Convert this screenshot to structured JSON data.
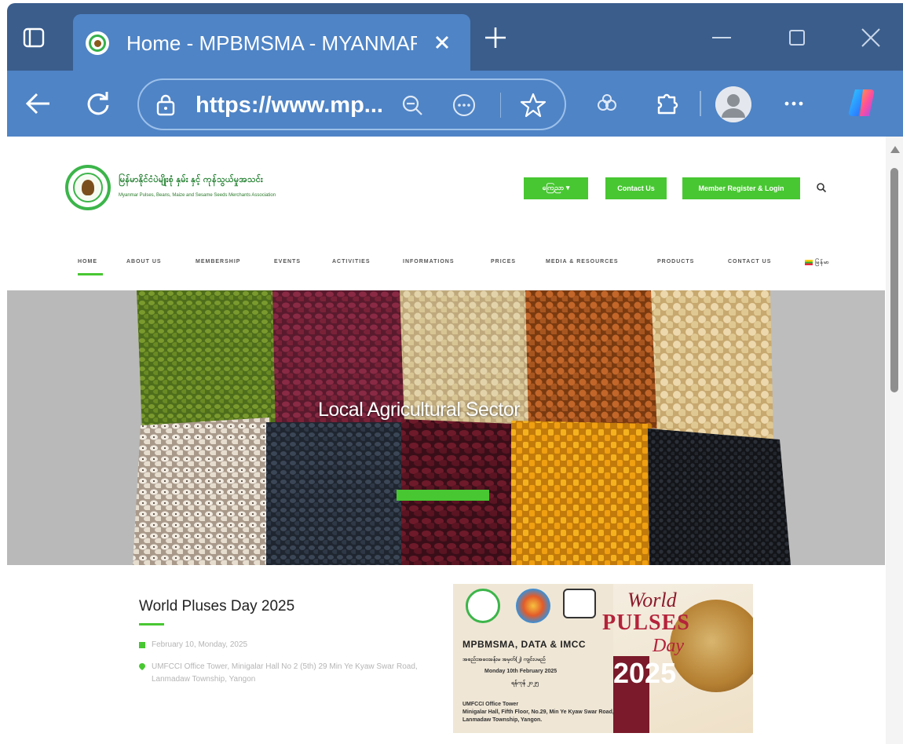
{
  "browser": {
    "tab_title": "Home - MPBMSMA - MYANMAR",
    "url": "https://www.mp...",
    "icons": [
      "tab-actions-icon",
      "favicon",
      "close-icon",
      "new-tab-icon",
      "minimize-icon",
      "maximize-icon",
      "window-close-icon",
      "back-icon",
      "refresh-icon",
      "site-info-icon",
      "zoom-out-icon",
      "more-in-address-icon",
      "favorite-star-icon",
      "extensions-icon",
      "collections-icon",
      "profile-avatar-icon",
      "settings-more-icon",
      "copilot-icon"
    ],
    "accent": "#4f84c6",
    "tabstrip_color": "#3a5d8c"
  },
  "site": {
    "logo_title": "မြန်မာနိုင်ငံပဲမျိုးစုံ နှမ်း နှင့် ကုန်သွယ်မှုအသင်း",
    "logo_subtitle": "Myanmar Pulses, Beans, Maize and Sesame Seeds Merchants Association",
    "header_buttons": {
      "language": "ကြေညာ ▾",
      "contact": "Contact Us",
      "member": "Member Register & Login"
    },
    "nav": [
      "HOME",
      "ABOUT US",
      "MEMBERSHIP",
      "EVENTS",
      "ACTIVITIES",
      "INFORMATIONS",
      "PRICES",
      "MEDIA & RESOURCES",
      "PRODUCTS",
      "CONTACT US",
      "မြန်မာ"
    ],
    "brand_green": "#48c732"
  },
  "hero": {
    "caption": "Local Agricultural Sector"
  },
  "post": {
    "title": "World Pluses Day 2025",
    "date": "February 10, Monday, 2025",
    "location": "UMFCCI Office Tower, Minigalar Hall No 2 (5th) 29 Min Ye Kyaw Swar Road, Lanmadaw Township, Yangon",
    "image": {
      "heading": "MPBMSMA, DATA & IMCC",
      "line1": "အစည်းအဝေးခန်းမ အမှတ်(၂) ကျင်းပမည်",
      "line2": "Monday 10th February 2025",
      "line3": "ရန်ကုန် ၂၀၂၅",
      "line4": "UMFCCI Office Tower",
      "line5": "Minigalar Hall, Fifth Floor, No.29, Min Ye Kyaw Swar Road,",
      "line6": "Lanmadaw Township, Yangon.",
      "world": "World",
      "pulses": "PULSES",
      "day": "Day",
      "year": "2025"
    }
  }
}
